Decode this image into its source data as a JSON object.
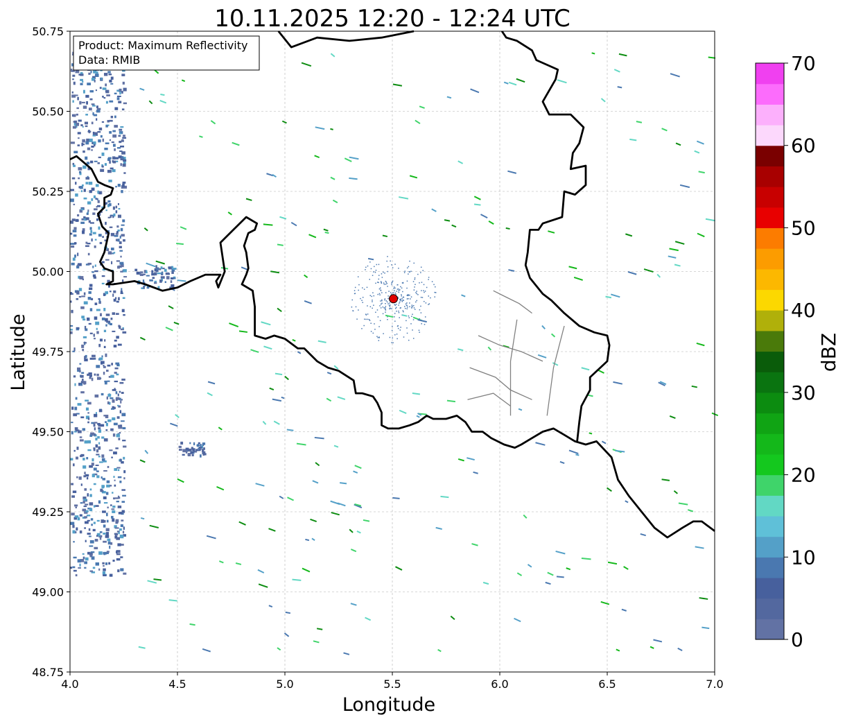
{
  "title": "10.11.2025 12:20 - 12:24 UTC",
  "info_box": {
    "product_line": "Product: Maximum Reflectivity",
    "data_line": "Data: RMIB"
  },
  "axes": {
    "xlabel": "Longitude",
    "ylabel": "Latitude",
    "xlim": [
      4.0,
      7.0
    ],
    "ylim": [
      48.75,
      50.75
    ],
    "xticks": [
      "4.0",
      "4.5",
      "5.0",
      "5.5",
      "6.0",
      "6.5",
      "7.0"
    ],
    "yticks": [
      "48.75",
      "49.00",
      "49.25",
      "49.50",
      "49.75",
      "50.00",
      "50.25",
      "50.50",
      "50.75"
    ],
    "grid": true
  },
  "colorbar": {
    "label": "dBZ",
    "range": [
      0,
      70
    ],
    "step": 2.5,
    "ticks": [
      "0",
      "10",
      "20",
      "30",
      "40",
      "50",
      "60",
      "70"
    ],
    "colors": [
      "#6272a4",
      "#53689f",
      "#47609d",
      "#4a78b0",
      "#54a0c8",
      "#5fc0d8",
      "#62d8c4",
      "#3fd46a",
      "#14c81e",
      "#14b81a",
      "#10a414",
      "#0c8c10",
      "#0a7410",
      "#0a5c0a",
      "#4a7a0a",
      "#b0b00a",
      "#fcd800",
      "#fcb800",
      "#fc9c00",
      "#fc7c00",
      "#e80000",
      "#c80000",
      "#a80000",
      "#7a0000",
      "#fcd8fc",
      "#fcb0fc",
      "#fc6cfc",
      "#f040f0"
    ]
  },
  "radar_site": {
    "lon": 5.505,
    "lat": 49.915,
    "color": "#e00000"
  },
  "boundaries": {
    "national": [
      [
        [
          4.0,
          50.35
        ],
        [
          4.03,
          50.36
        ],
        [
          4.1,
          50.32
        ],
        [
          4.13,
          50.28
        ],
        [
          4.16,
          50.27
        ],
        [
          4.2,
          50.26
        ],
        [
          4.19,
          50.24
        ],
        [
          4.16,
          50.23
        ],
        [
          4.16,
          50.2
        ],
        [
          4.13,
          50.18
        ],
        [
          4.15,
          50.14
        ],
        [
          4.18,
          50.12
        ],
        [
          4.16,
          50.06
        ],
        [
          4.14,
          50.03
        ],
        [
          4.16,
          50.01
        ],
        [
          4.2,
          50.0
        ],
        [
          4.2,
          49.97
        ],
        [
          4.17,
          49.96
        ],
        [
          4.2,
          49.96
        ],
        [
          4.3,
          49.97
        ],
        [
          4.35,
          49.96
        ],
        [
          4.43,
          49.94
        ],
        [
          4.5,
          49.95
        ],
        [
          4.56,
          49.97
        ],
        [
          4.63,
          49.99
        ],
        [
          4.7,
          49.99
        ],
        [
          4.68,
          49.97
        ],
        [
          4.69,
          49.95
        ],
        [
          4.72,
          50.0
        ],
        [
          4.7,
          50.09
        ],
        [
          4.76,
          50.13
        ],
        [
          4.82,
          50.17
        ],
        [
          4.87,
          50.15
        ],
        [
          4.86,
          50.13
        ],
        [
          4.83,
          50.12
        ],
        [
          4.81,
          50.08
        ],
        [
          4.82,
          50.06
        ],
        [
          4.83,
          50.01
        ],
        [
          4.82,
          49.99
        ],
        [
          4.8,
          49.96
        ],
        [
          4.85,
          49.94
        ],
        [
          4.86,
          49.89
        ],
        [
          4.86,
          49.86
        ],
        [
          4.86,
          49.8
        ],
        [
          4.91,
          49.79
        ],
        [
          4.95,
          49.8
        ],
        [
          5.0,
          49.79
        ],
        [
          5.06,
          49.76
        ],
        [
          5.09,
          49.76
        ],
        [
          5.15,
          49.72
        ],
        [
          5.2,
          49.7
        ],
        [
          5.25,
          49.69
        ],
        [
          5.32,
          49.66
        ],
        [
          5.33,
          49.62
        ],
        [
          5.36,
          49.62
        ],
        [
          5.41,
          49.61
        ],
        [
          5.43,
          49.59
        ],
        [
          5.45,
          49.56
        ],
        [
          5.45,
          49.52
        ],
        [
          5.48,
          49.51
        ],
        [
          5.53,
          49.51
        ],
        [
          5.58,
          49.52
        ],
        [
          5.62,
          49.53
        ],
        [
          5.66,
          49.55
        ],
        [
          5.69,
          49.54
        ],
        [
          5.75,
          49.54
        ],
        [
          5.8,
          49.55
        ],
        [
          5.84,
          49.53
        ],
        [
          5.87,
          49.5
        ],
        [
          5.92,
          49.5
        ],
        [
          5.96,
          49.48
        ],
        [
          6.02,
          49.46
        ],
        [
          6.07,
          49.45
        ],
        [
          6.1,
          49.46
        ],
        [
          6.15,
          49.48
        ],
        [
          6.2,
          49.5
        ],
        [
          6.25,
          49.51
        ],
        [
          6.3,
          49.49
        ],
        [
          6.35,
          49.47
        ],
        [
          6.4,
          49.46
        ],
        [
          6.45,
          49.47
        ],
        [
          6.52,
          49.42
        ],
        [
          6.55,
          49.35
        ],
        [
          6.6,
          49.3
        ],
        [
          6.66,
          49.25
        ],
        [
          6.72,
          49.2
        ],
        [
          6.78,
          49.17
        ],
        [
          6.85,
          49.2
        ],
        [
          6.9,
          49.22
        ],
        [
          6.94,
          49.22
        ],
        [
          7.0,
          49.19
        ]
      ],
      [
        [
          4.97,
          50.75
        ],
        [
          5.03,
          50.7
        ],
        [
          5.15,
          50.73
        ],
        [
          5.3,
          50.72
        ],
        [
          5.45,
          50.73
        ],
        [
          5.6,
          50.75
        ]
      ],
      [
        [
          6.01,
          50.75
        ],
        [
          6.03,
          50.73
        ],
        [
          6.08,
          50.72
        ],
        [
          6.15,
          50.69
        ],
        [
          6.17,
          50.66
        ],
        [
          6.27,
          50.63
        ],
        [
          6.26,
          50.6
        ],
        [
          6.2,
          50.53
        ],
        [
          6.23,
          50.49
        ],
        [
          6.33,
          50.49
        ],
        [
          6.39,
          50.45
        ],
        [
          6.37,
          50.4
        ],
        [
          6.34,
          50.37
        ],
        [
          6.33,
          50.32
        ],
        [
          6.4,
          50.33
        ],
        [
          6.4,
          50.27
        ],
        [
          6.35,
          50.24
        ],
        [
          6.3,
          50.25
        ],
        [
          6.29,
          50.17
        ],
        [
          6.2,
          50.15
        ],
        [
          6.18,
          50.13
        ],
        [
          6.14,
          50.13
        ],
        [
          6.13,
          50.06
        ],
        [
          6.12,
          50.02
        ],
        [
          6.14,
          49.98
        ],
        [
          6.2,
          49.93
        ],
        [
          6.24,
          49.91
        ],
        [
          6.3,
          49.87
        ],
        [
          6.37,
          49.83
        ],
        [
          6.44,
          49.81
        ],
        [
          6.5,
          49.8
        ],
        [
          6.51,
          49.77
        ],
        [
          6.5,
          49.72
        ],
        [
          6.42,
          49.67
        ],
        [
          6.42,
          49.63
        ],
        [
          6.38,
          49.58
        ],
        [
          6.37,
          49.53
        ],
        [
          6.36,
          49.47
        ]
      ]
    ],
    "provincial": [
      [
        [
          5.97,
          49.94
        ],
        [
          6.03,
          49.92
        ],
        [
          6.09,
          49.9
        ],
        [
          6.15,
          49.87
        ]
      ],
      [
        [
          5.9,
          49.8
        ],
        [
          6.0,
          49.77
        ],
        [
          6.1,
          49.75
        ],
        [
          6.2,
          49.72
        ]
      ],
      [
        [
          5.86,
          49.7
        ],
        [
          5.98,
          49.67
        ],
        [
          6.05,
          49.63
        ],
        [
          6.15,
          49.6
        ]
      ],
      [
        [
          6.08,
          49.85
        ],
        [
          6.05,
          49.72
        ],
        [
          6.05,
          49.55
        ]
      ],
      [
        [
          6.3,
          49.83
        ],
        [
          6.25,
          49.7
        ],
        [
          6.22,
          49.55
        ]
      ],
      [
        [
          5.85,
          49.6
        ],
        [
          5.97,
          49.62
        ],
        [
          6.05,
          49.58
        ]
      ]
    ]
  }
}
